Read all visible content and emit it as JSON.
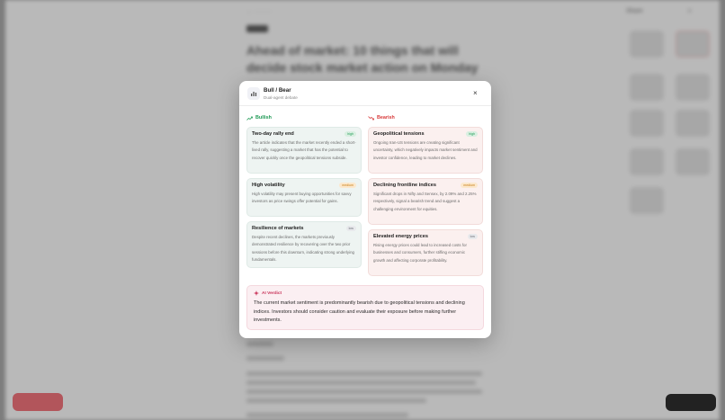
{
  "modal": {
    "title": "Bull / Bear",
    "subtitle": "Dual-agent debate",
    "close": "×",
    "icon": "chart-bars-icon"
  },
  "bullish": {
    "heading": "Bullish",
    "color": "#1f9a55",
    "items": [
      {
        "title": "Two-day rally end",
        "badge": "high",
        "text": "The article indicates that the market recently ended a short-lived rally, suggesting a market that has the potential to recover quickly once the geopolitical tensions subside."
      },
      {
        "title": "High volatility",
        "badge": "medium",
        "text": "High volatility may present buying opportunities for savvy investors as price swings offer potential for gains."
      },
      {
        "title": "Resilience of markets",
        "badge": "low",
        "text": "Despite recent declines, the markets previously demonstrated resilience by recovering over the two prior sessions before this downturn, indicating strong underlying fundamentals."
      }
    ]
  },
  "bearish": {
    "heading": "Bearish",
    "color": "#d83b3b",
    "items": [
      {
        "title": "Geopolitical tensions",
        "badge": "high",
        "text": "Ongoing Iran-US tensions are creating significant uncertainty, which negatively impacts market sentiment and investor confidence, leading to market declines."
      },
      {
        "title": "Declining frontline indices",
        "badge": "medium",
        "text": "Significant drops in Nifty and Sensex, by 2.09% and 2.25% respectively, signal a bearish trend and suggest a challenging environment for equities."
      },
      {
        "title": "Elevated energy prices",
        "badge": "low",
        "text": "Rising energy prices could lead to increased costs for businesses and consumers, further stifling economic growth and affecting corporate profitability."
      }
    ]
  },
  "verdict": {
    "heading": "AI Verdict",
    "text": "The current market sentiment is predominantly bearish due to geopolitical tensions and declining indices. Investors should consider caution and evaluate their exposure before making further investments."
  },
  "background": {
    "title": "Ahead of market: 10 things that will decide stock market action on Monday",
    "share": "Share"
  }
}
